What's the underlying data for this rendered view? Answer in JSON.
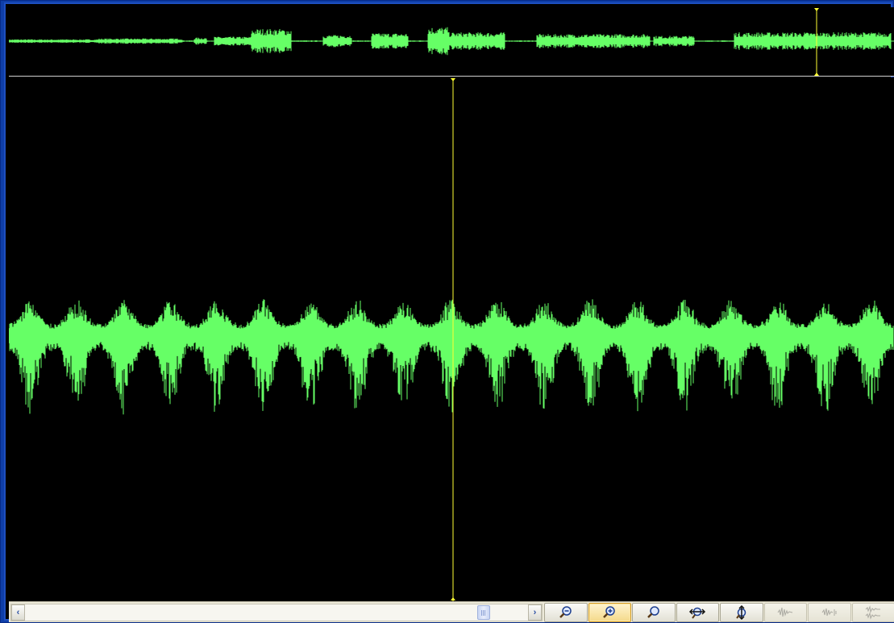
{
  "colors": {
    "waveform": "#66ff66",
    "cursor": "#ffff33",
    "background": "#000000",
    "frame": "#0f3ea8"
  },
  "scrollbar": {
    "left_icon": "chevron-left-icon",
    "right_icon": "chevron-right-icon",
    "position": 0.88
  },
  "toolbar": {
    "buttons": [
      {
        "icon": "zoom-out-icon"
      },
      {
        "icon": "zoom-in-icon"
      },
      {
        "icon": "zoom-selection-icon"
      },
      {
        "icon": "zoom-horizontal-icon"
      },
      {
        "icon": "zoom-vertical-icon"
      },
      {
        "icon": "waveform-icon"
      },
      {
        "icon": "waveform-compare-icon"
      },
      {
        "icon": "waveform-split-icon"
      }
    ]
  }
}
